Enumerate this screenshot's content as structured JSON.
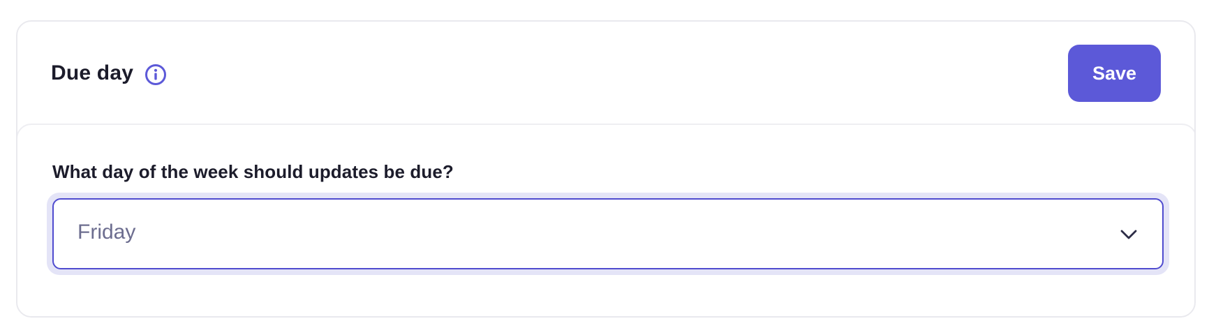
{
  "section": {
    "title": "Due day",
    "info_icon": "info-circle-icon",
    "save_label": "Save"
  },
  "form": {
    "question": "What day of the week should updates be due?",
    "due_day_select": {
      "selected": "Friday",
      "icon": "chevron-down-icon"
    }
  },
  "colors": {
    "accent": "#5c59d8",
    "focus_border": "#4f4bcf",
    "focus_ring": "#e4e4f7",
    "title_text": "#1c1c2b",
    "select_text": "#6c6d8f",
    "card_border": "#e9e9ee"
  }
}
